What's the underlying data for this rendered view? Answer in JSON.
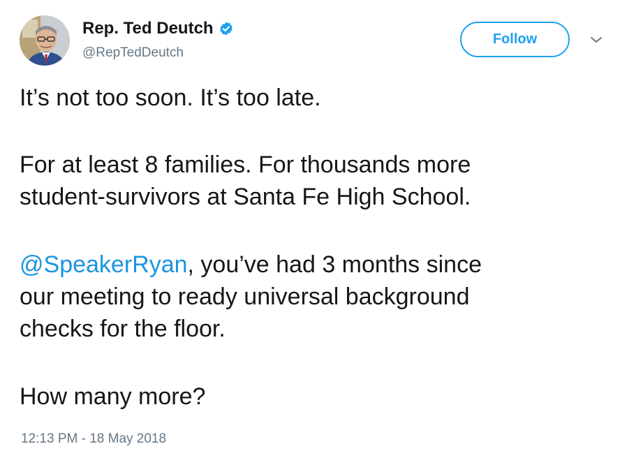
{
  "author": {
    "display_name": "Rep. Ted Deutch",
    "handle": "@RepTedDeutch",
    "verified": true
  },
  "follow_button": {
    "label": "Follow"
  },
  "icons": {
    "verified": "verified-badge-icon",
    "caret": "chevron-down-icon",
    "avatar": "profile-photo"
  },
  "tweet": {
    "line1": "It’s not too soon. It’s too late.",
    "line2": "For at least 8 families. For thousands more",
    "line3": "student-survivors at Santa Fe High School.",
    "mention": "@SpeakerRyan",
    "line4_rest": ", you’ve had 3 months since",
    "line5": "our meeting to ready universal background",
    "line6": "checks for the floor.",
    "line7": "How many more?",
    "timestamp": "12:13 PM - 18 May 2018"
  },
  "colors": {
    "accent": "#1da1f2",
    "link": "#1b95e0",
    "text": "#14171a",
    "secondary": "#657786"
  }
}
